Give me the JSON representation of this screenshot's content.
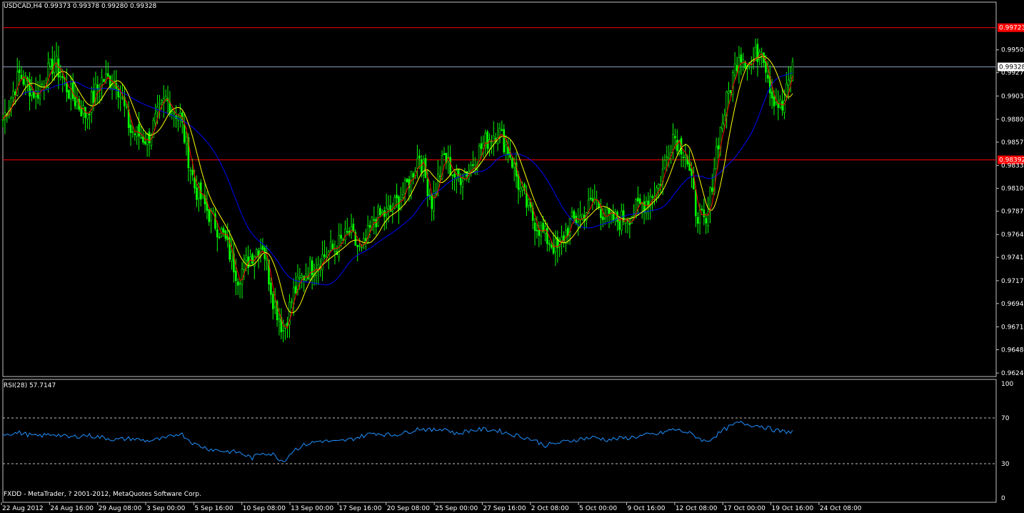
{
  "header": {
    "symbol_line": "USDCAD,H4  0.99373 0.99378 0.99280 0.99328",
    "rsi_line": "RSI(28) 57.7147",
    "footer": "FXDD - MetaTrader, ? 2001-2012, MetaQuotes Software Corp."
  },
  "colors": {
    "background": "#000000",
    "frame": "#c0c0c0",
    "bull_candle": "#00ff00",
    "ma_fast": "#ff0000",
    "ma_mid": "#ffff00",
    "ma_slow": "#0000ff",
    "rsi_line": "#1e90ff",
    "hline": "#ff0000",
    "bid_line": "#8fa0c0"
  },
  "chart_data": [
    {
      "type": "candlestick",
      "symbol": "USDCAD",
      "timeframe": "H4",
      "y_ticks": [
        "0.99500",
        "0.99270",
        "0.99035",
        "0.98800",
        "0.98570",
        "0.98335",
        "0.98105",
        "0.97875",
        "0.97640",
        "0.97410",
        "0.97175",
        "0.96945",
        "0.96710",
        "0.96480",
        "0.96245"
      ],
      "ylim": [
        0.9621,
        0.9998
      ],
      "x_ticks": [
        "22 Aug 2012",
        "24 Aug 16:00",
        "29 Aug 08:00",
        "3 Sep 00:00",
        "5 Sep 16:00",
        "10 Sep 08:00",
        "13 Sep 00:00",
        "17 Sep 16:00",
        "20 Sep 08:00",
        "25 Sep 00:00",
        "27 Sep 16:00",
        "2 Oct 08:00",
        "5 Oct 00:00",
        "9 Oct 16:00",
        "12 Oct 08:00",
        "17 Oct 00:00",
        "19 Oct 16:00",
        "24 Oct 08:00"
      ],
      "horizontal_lines": [
        {
          "label": "0.99723",
          "value": 0.99723,
          "color": "#ff0000"
        },
        {
          "label": "0.98392",
          "value": 0.98392,
          "color": "#ff0000"
        }
      ],
      "bid_line": {
        "label": "0.99328",
        "value": 0.99328
      },
      "close_anchors": [
        [
          0,
          0.988
        ],
        [
          8,
          0.9925
        ],
        [
          16,
          0.9905
        ],
        [
          25,
          0.9938
        ],
        [
          32,
          0.9908
        ],
        [
          40,
          0.9885
        ],
        [
          48,
          0.992
        ],
        [
          55,
          0.992
        ],
        [
          62,
          0.9868
        ],
        [
          70,
          0.986
        ],
        [
          79,
          0.99
        ],
        [
          86,
          0.9882
        ],
        [
          93,
          0.9812
        ],
        [
          100,
          0.9785
        ],
        [
          107,
          0.9762
        ],
        [
          114,
          0.9722
        ],
        [
          121,
          0.9745
        ],
        [
          126,
          0.9755
        ],
        [
          131,
          0.97
        ],
        [
          136,
          0.9668
        ],
        [
          141,
          0.9705
        ],
        [
          147,
          0.9727
        ],
        [
          154,
          0.974
        ],
        [
          162,
          0.9752
        ],
        [
          168,
          0.9765
        ],
        [
          174,
          0.9745
        ],
        [
          180,
          0.978
        ],
        [
          188,
          0.9787
        ],
        [
          195,
          0.9808
        ],
        [
          202,
          0.9845
        ],
        [
          208,
          0.9797
        ],
        [
          214,
          0.9842
        ],
        [
          220,
          0.982
        ],
        [
          226,
          0.983
        ],
        [
          233,
          0.9855
        ],
        [
          240,
          0.987
        ],
        [
          246,
          0.9845
        ],
        [
          251,
          0.9808
        ],
        [
          257,
          0.978
        ],
        [
          263,
          0.9762
        ],
        [
          269,
          0.9748
        ],
        [
          275,
          0.9775
        ],
        [
          281,
          0.9783
        ],
        [
          287,
          0.98
        ],
        [
          293,
          0.978
        ],
        [
          299,
          0.9778
        ],
        [
          305,
          0.9785
        ],
        [
          312,
          0.9798
        ],
        [
          318,
          0.9813
        ],
        [
          325,
          0.9865
        ],
        [
          331,
          0.9848
        ],
        [
          336,
          0.979
        ],
        [
          341,
          0.977
        ],
        [
          346,
          0.985
        ],
        [
          351,
          0.9898
        ],
        [
          357,
          0.9948
        ],
        [
          363,
          0.9935
        ],
        [
          368,
          0.9955
        ],
        [
          373,
          0.9905
        ],
        [
          378,
          0.989
        ],
        [
          383,
          0.9933
        ]
      ],
      "series_names": []
    },
    {
      "type": "line",
      "indicator": "RSI(28)",
      "current_value": 57.7147,
      "ylim": [
        0,
        100
      ],
      "y_ticks": [
        "100",
        "70",
        "30",
        "0"
      ],
      "levels": [
        70,
        30
      ],
      "points": [
        [
          0,
          56
        ],
        [
          8,
          57
        ],
        [
          16,
          54
        ],
        [
          25,
          56
        ],
        [
          32,
          53
        ],
        [
          40,
          55
        ],
        [
          48,
          53
        ],
        [
          55,
          51
        ],
        [
          62,
          52
        ],
        [
          70,
          50
        ],
        [
          79,
          52
        ],
        [
          86,
          57
        ],
        [
          93,
          47
        ],
        [
          100,
          43
        ],
        [
          107,
          41
        ],
        [
          114,
          40
        ],
        [
          121,
          35
        ],
        [
          126,
          40
        ],
        [
          131,
          38
        ],
        [
          136,
          32
        ],
        [
          141,
          42
        ],
        [
          147,
          47
        ],
        [
          154,
          50
        ],
        [
          162,
          49
        ],
        [
          168,
          51
        ],
        [
          174,
          54
        ],
        [
          180,
          57
        ],
        [
          188,
          55
        ],
        [
          195,
          57
        ],
        [
          202,
          61
        ],
        [
          208,
          59
        ],
        [
          214,
          61
        ],
        [
          220,
          56
        ],
        [
          226,
          59
        ],
        [
          233,
          60
        ],
        [
          240,
          59
        ],
        [
          246,
          56
        ],
        [
          251,
          54
        ],
        [
          257,
          51
        ],
        [
          263,
          46
        ],
        [
          269,
          48
        ],
        [
          275,
          50
        ],
        [
          281,
          52
        ],
        [
          287,
          53
        ],
        [
          293,
          51
        ],
        [
          299,
          52
        ],
        [
          305,
          53
        ],
        [
          312,
          55
        ],
        [
          318,
          56
        ],
        [
          325,
          60
        ],
        [
          331,
          58
        ],
        [
          336,
          54
        ],
        [
          341,
          49
        ],
        [
          346,
          55
        ],
        [
          351,
          61
        ],
        [
          357,
          66
        ],
        [
          363,
          64
        ],
        [
          368,
          63
        ],
        [
          373,
          60
        ],
        [
          378,
          58
        ],
        [
          383,
          58
        ]
      ]
    }
  ]
}
